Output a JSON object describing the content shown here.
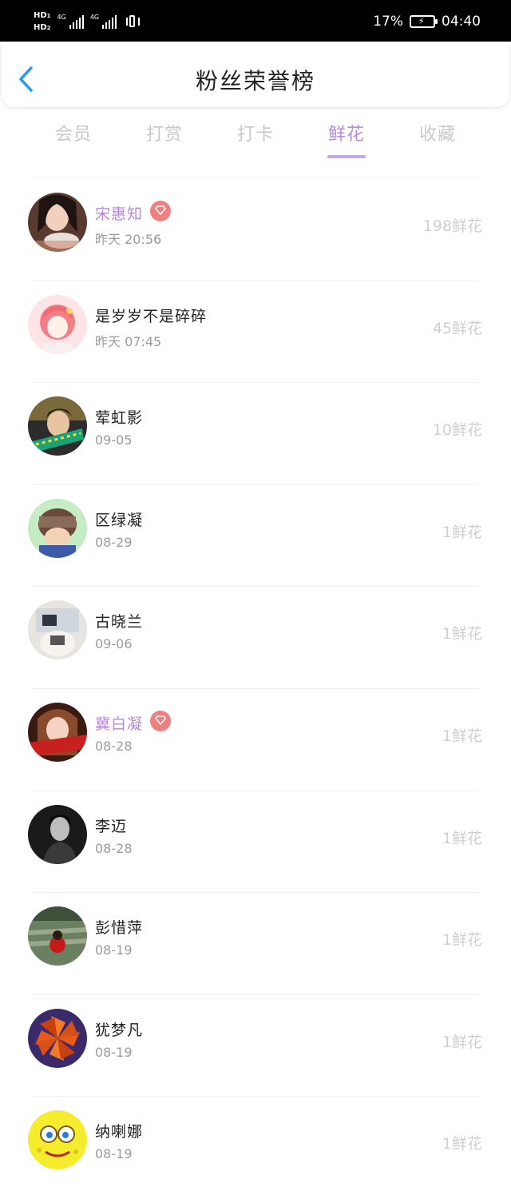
{
  "status_bar": {
    "hd1": "HD",
    "hd1_sub": "1",
    "hd2": "HD",
    "hd2_sub": "2",
    "net1": "4G",
    "net2": "4G",
    "battery_percent": "17%",
    "clock": "04:40",
    "icons": [
      "signal-icon",
      "vibrate-icon",
      "battery-charging-icon"
    ]
  },
  "header": {
    "title": "粉丝荣誉榜",
    "back_icon": "chevron-left-icon",
    "accent_color": "#2a9be8"
  },
  "tabs": [
    {
      "label": "会员",
      "active": false
    },
    {
      "label": "打赏",
      "active": false
    },
    {
      "label": "打卡",
      "active": false
    },
    {
      "label": "鲜花",
      "active": true
    },
    {
      "label": "收藏",
      "active": false
    }
  ],
  "colors": {
    "tab_active": "#b78be0",
    "vip_name": "#b48ad8",
    "badge": "#ef8080"
  },
  "fans": [
    {
      "name": "宋惠知",
      "time": "昨天 20:56",
      "count": "198鲜花",
      "vip": true
    },
    {
      "name": "是岁岁不是碎碎",
      "time": "昨天 07:45",
      "count": "45鲜花",
      "vip": false
    },
    {
      "name": "荤虹影",
      "time": "09-05",
      "count": "10鲜花",
      "vip": false
    },
    {
      "name": "区绿凝",
      "time": "08-29",
      "count": "1鲜花",
      "vip": false
    },
    {
      "name": "古晓兰",
      "time": "09-06",
      "count": "1鲜花",
      "vip": false
    },
    {
      "name": "冀白凝",
      "time": "08-28",
      "count": "1鲜花",
      "vip": true
    },
    {
      "name": "李迈",
      "time": "08-28",
      "count": "1鲜花",
      "vip": false
    },
    {
      "name": "彭惜萍",
      "time": "08-19",
      "count": "1鲜花",
      "vip": false
    },
    {
      "name": "犹梦凡",
      "time": "08-19",
      "count": "1鲜花",
      "vip": false
    },
    {
      "name": "纳喇娜",
      "time": "08-19",
      "count": "1鲜花",
      "vip": false
    }
  ]
}
